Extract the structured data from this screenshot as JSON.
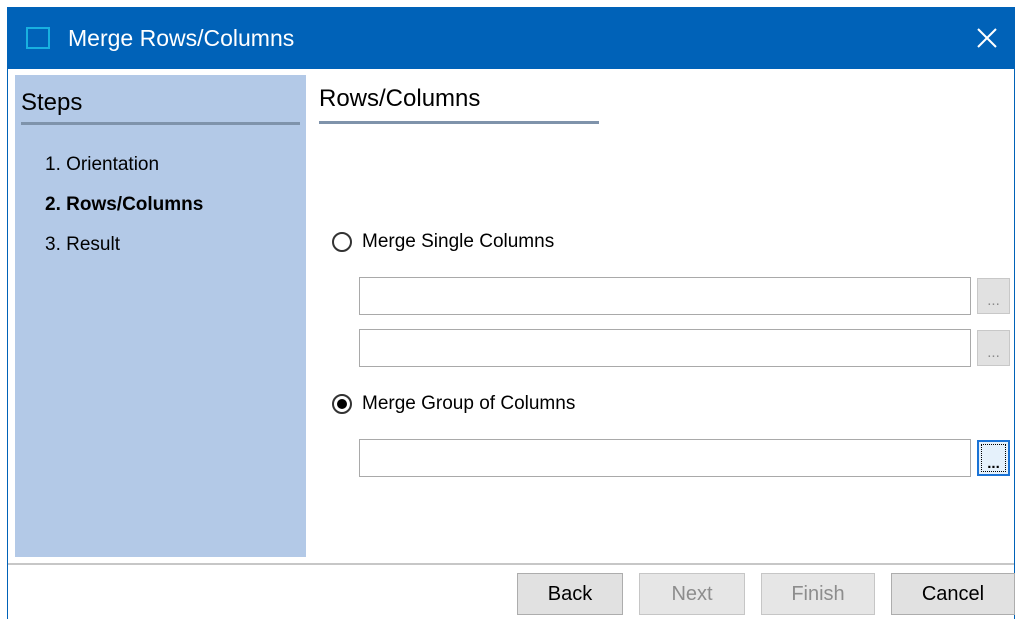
{
  "window": {
    "title": "Merge Rows/Columns",
    "icon": "app-window-icon",
    "close_icon": "close-icon"
  },
  "steps": {
    "title": "Steps",
    "items": [
      {
        "label": "1. Orientation",
        "current": false
      },
      {
        "label": "2. Rows/Columns",
        "current": true
      },
      {
        "label": "3. Result",
        "current": false
      }
    ]
  },
  "main": {
    "title": "Rows/Columns",
    "options": [
      {
        "label": "Merge Single Columns",
        "selected": false
      },
      {
        "label": "Merge Group of Columns",
        "selected": true
      }
    ],
    "single_fields": [
      {
        "value": "",
        "browse_label": "..."
      },
      {
        "value": "",
        "browse_label": "..."
      }
    ],
    "group_field": {
      "value": "",
      "browse_label": "..."
    }
  },
  "footer": {
    "back_label": "Back",
    "next_label": "Next",
    "finish_label": "Finish",
    "cancel_label": "Cancel",
    "next_enabled": false,
    "finish_enabled": false
  },
  "colors": {
    "titlebar": "#0062b8",
    "steps_panel": "#b3c9e7",
    "focus_accent": "#1a73d6"
  }
}
